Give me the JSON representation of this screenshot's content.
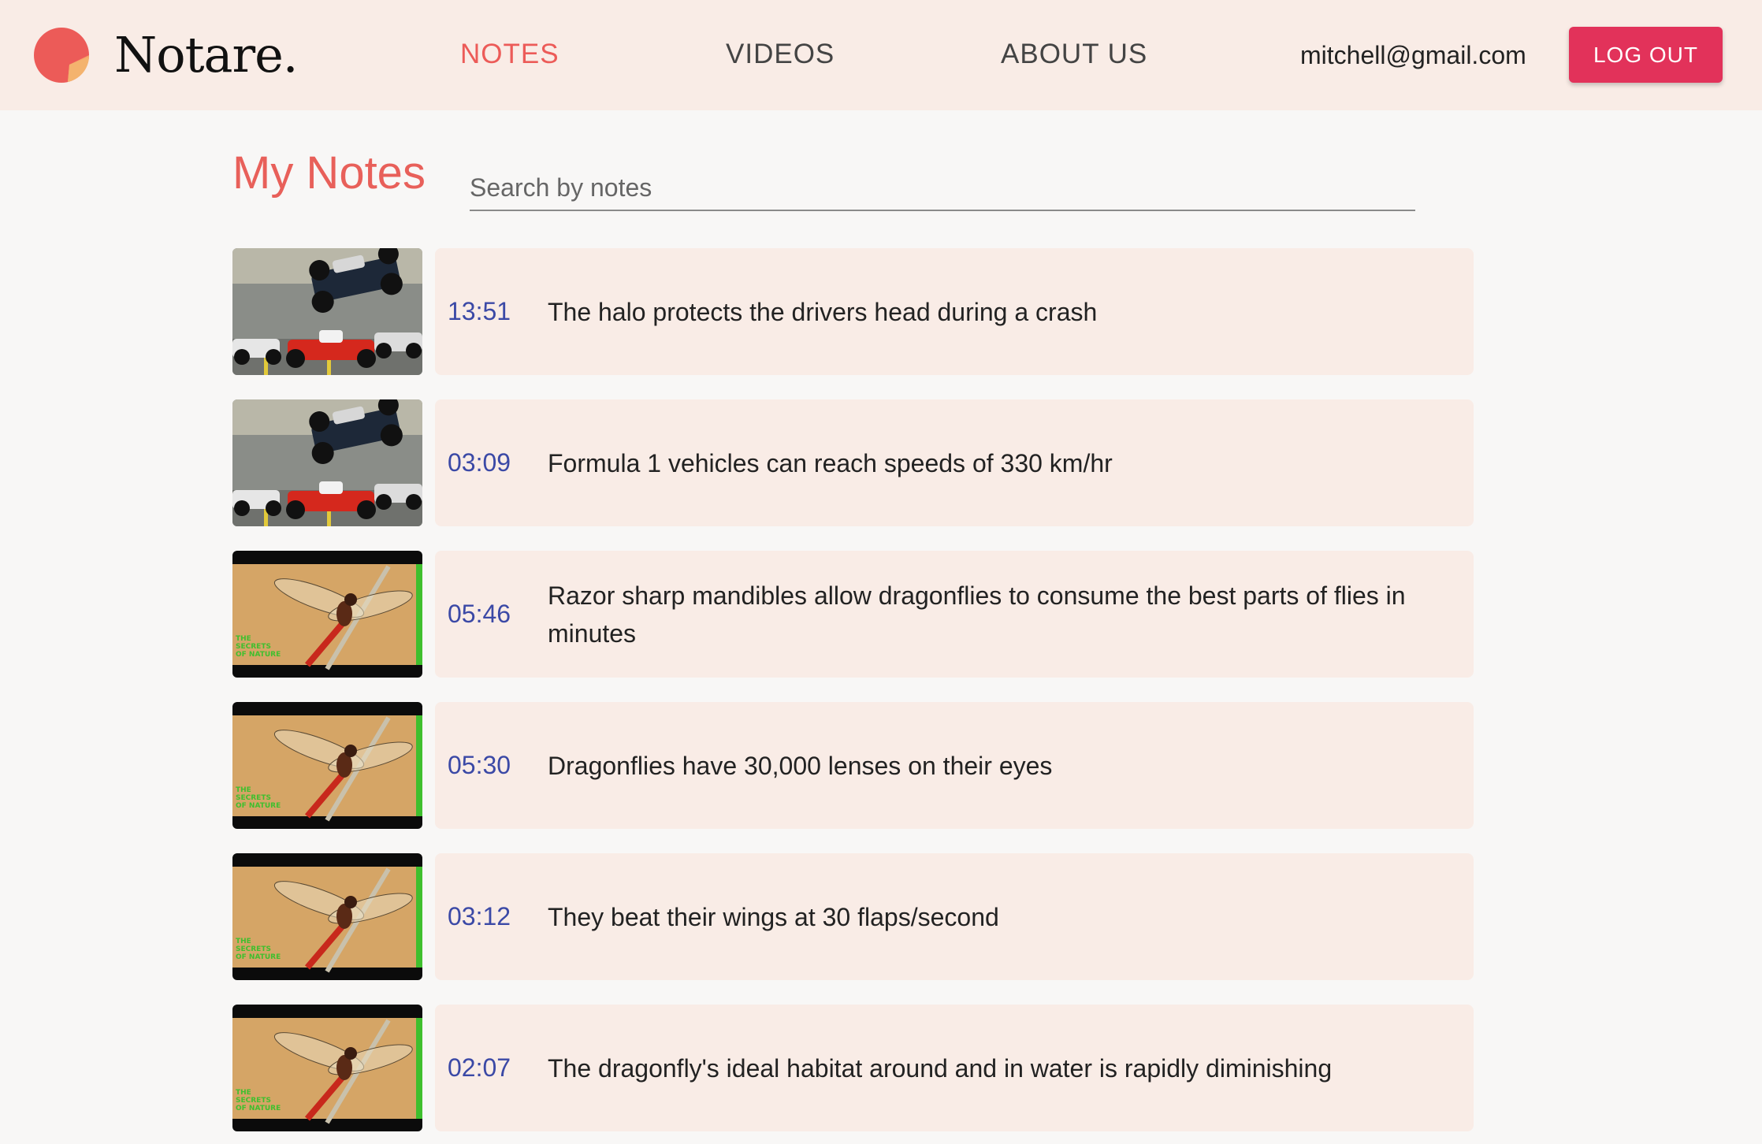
{
  "app": {
    "logo_text": "Notare.",
    "brand_color": "#ec5b58"
  },
  "nav": {
    "items": [
      {
        "label": "NOTES",
        "active": true
      },
      {
        "label": "VIDEOS",
        "active": false
      },
      {
        "label": "ABOUT US",
        "active": false
      }
    ],
    "user_email": "mitchell@gmail.com",
    "logout_label": "LOG OUT"
  },
  "page": {
    "title": "My Notes",
    "search_placeholder": "Search by notes",
    "search_value": ""
  },
  "notes": [
    {
      "time": "13:51",
      "text": "The halo protects the drivers head during a crash",
      "thumbnail": "formula1-crash"
    },
    {
      "time": "03:09",
      "text": "Formula 1 vehicles can reach speeds of 330 km/hr",
      "thumbnail": "formula1-crash"
    },
    {
      "time": "05:46",
      "text": "Razor sharp mandibles allow dragonflies to consume the best parts of flies in minutes",
      "thumbnail": "dragonfly"
    },
    {
      "time": "05:30",
      "text": "Dragonflies have 30,000 lenses on their eyes",
      "thumbnail": "dragonfly"
    },
    {
      "time": "03:12",
      "text": "They beat their wings at 30 flaps/second",
      "thumbnail": "dragonfly"
    },
    {
      "time": "02:07",
      "text": "The dragonfly's ideal habitat around and in water is rapidly diminishing",
      "thumbnail": "dragonfly"
    }
  ],
  "thumbnail_caption": "THE SECRETS OF NATURE"
}
